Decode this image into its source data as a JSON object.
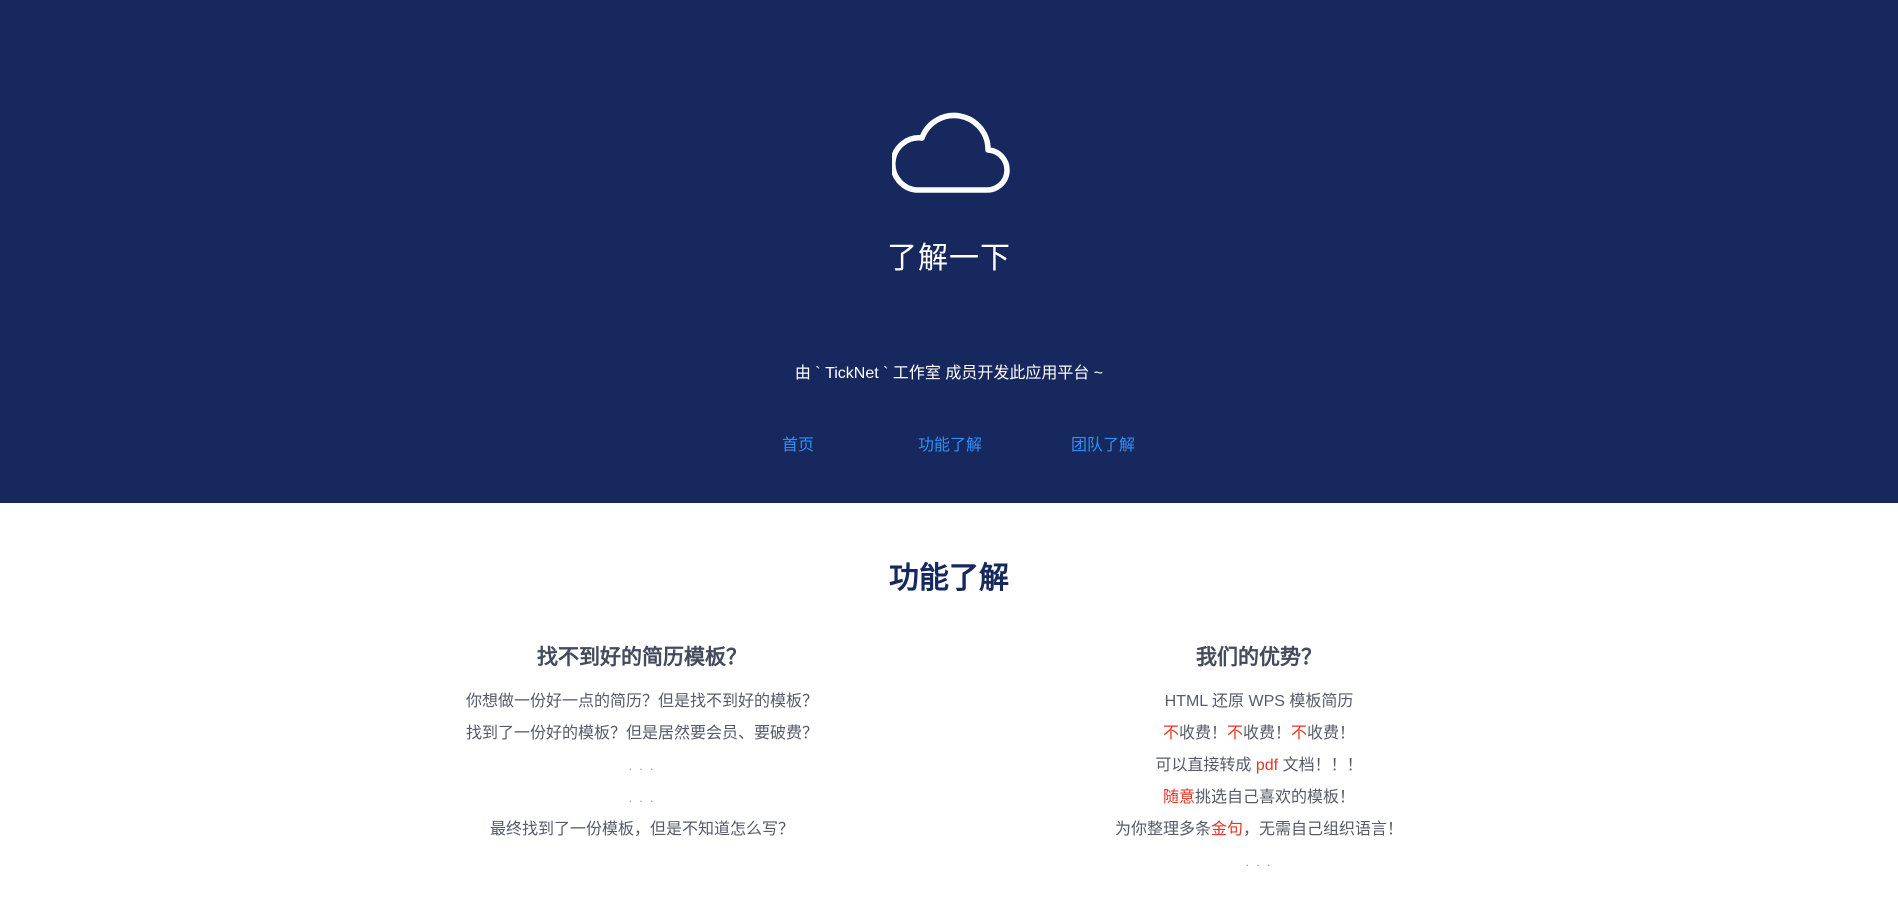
{
  "hero": {
    "title": "了解一下",
    "subtitle": "由 ` TickNet ` 工作室 成员开发此应用平台 ~",
    "nav": [
      {
        "label": "首页"
      },
      {
        "label": "功能了解"
      },
      {
        "label": "团队了解"
      }
    ]
  },
  "section": {
    "title": "功能了解",
    "left": {
      "heading": "找不到好的简历模板？",
      "lines": [
        "你想做一份好一点的简历？但是找不到好的模板？",
        "找到了一份好的模板？但是居然要会员、要破费？",
        ". . .",
        ". . .",
        "最终找到了一份模板，但是不知道怎么写？"
      ]
    },
    "right": {
      "heading": "我们的优势？",
      "line1": "HTML 还原 WPS 模板简历",
      "line2": [
        {
          "text": "不",
          "emph": true
        },
        {
          "text": "收费！",
          "emph": false
        },
        {
          "text": "不",
          "emph": true
        },
        {
          "text": "收费！",
          "emph": false
        },
        {
          "text": "不",
          "emph": true
        },
        {
          "text": "收费！",
          "emph": false
        }
      ],
      "line3": [
        {
          "text": "可以直接转成 ",
          "emph": false
        },
        {
          "text": "pdf",
          "emph": true
        },
        {
          "text": " 文档！！！",
          "emph": false
        }
      ],
      "line4": [
        {
          "text": "随意",
          "emph": true
        },
        {
          "text": "挑选自己喜欢的模板！",
          "emph": false
        }
      ],
      "line5": [
        {
          "text": "为你整理多条",
          "emph": false
        },
        {
          "text": "金句",
          "emph": true
        },
        {
          "text": "，无需自己组织语言！",
          "emph": false
        }
      ],
      "line6": ". . ."
    }
  },
  "colors": {
    "hero_background": "#17285e",
    "link": "#2f8ff5",
    "emphasis": "#e53624",
    "section_title": "#17285e"
  }
}
